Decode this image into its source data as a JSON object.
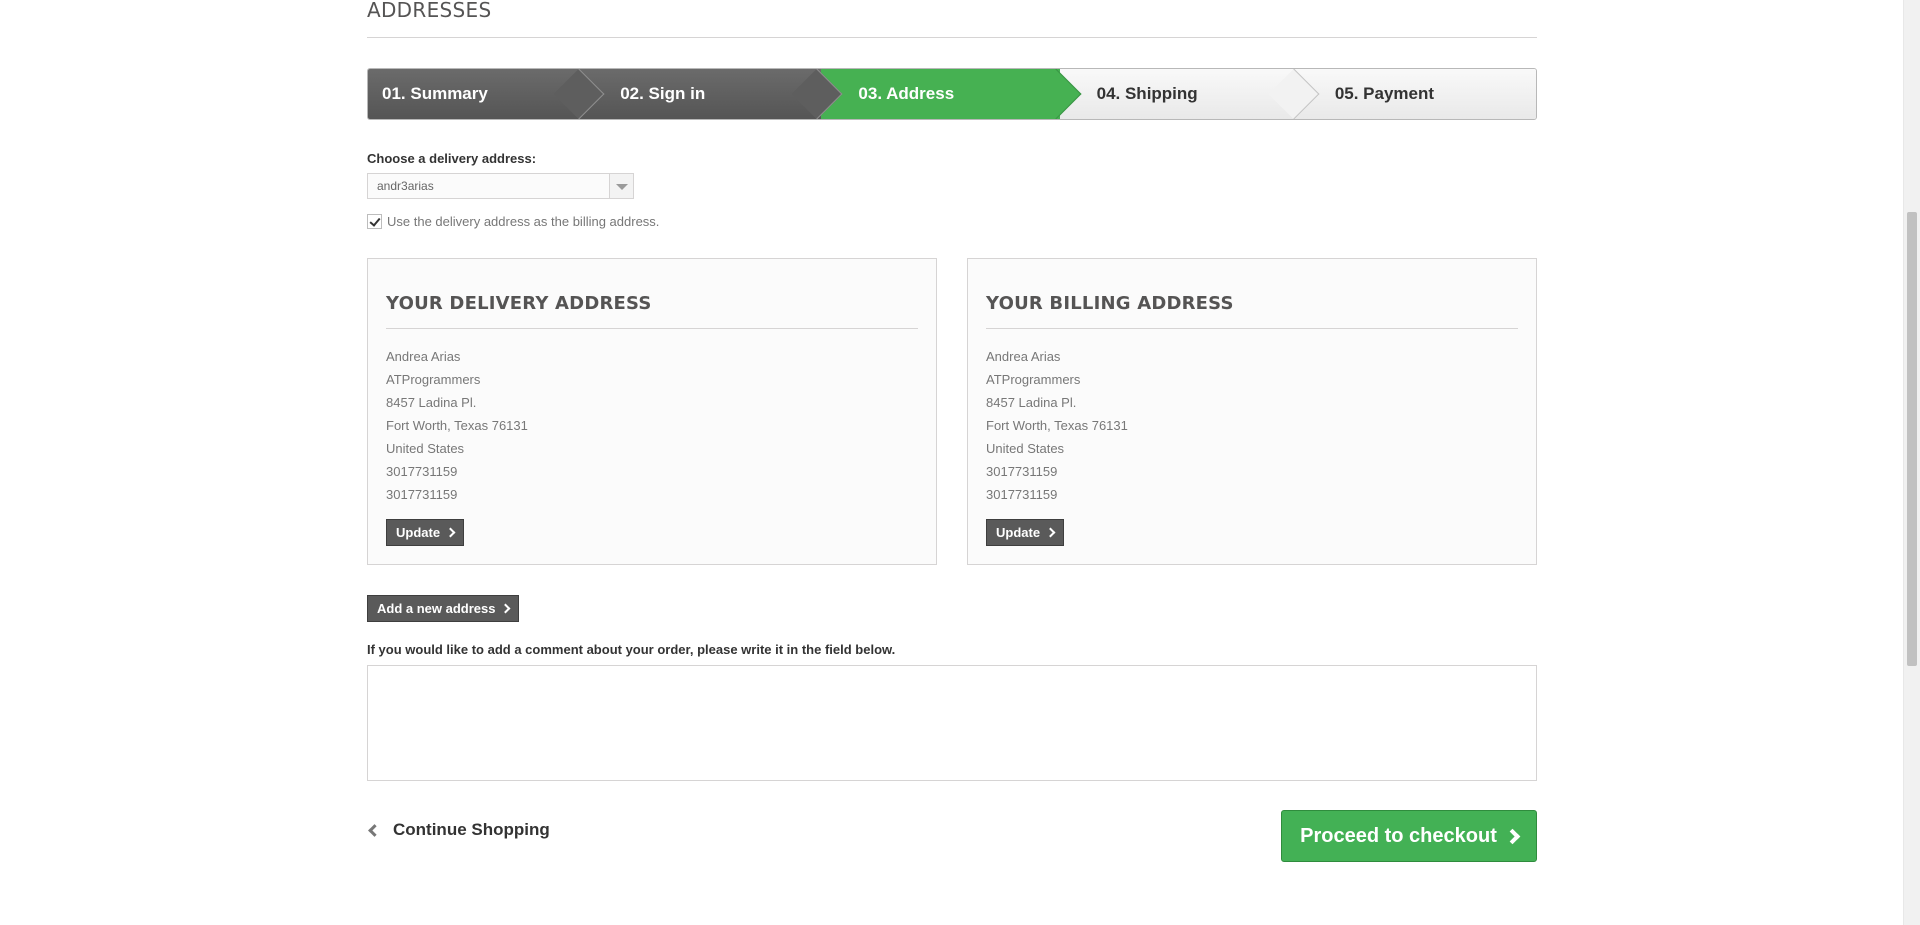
{
  "page": {
    "heading": "ADDRESSES"
  },
  "steps": [
    {
      "label": "01. Summary",
      "state": "done"
    },
    {
      "label": "02. Sign in",
      "state": "done"
    },
    {
      "label": "03. Address",
      "state": "current"
    },
    {
      "label": "04. Shipping",
      "state": "todo"
    },
    {
      "label": "05. Payment",
      "state": "todo"
    }
  ],
  "delivery_select": {
    "label": "Choose a delivery address:",
    "value": "andr3arias"
  },
  "billing_checkbox": {
    "label": "Use the delivery address as the billing address.",
    "checked": true
  },
  "delivery_address": {
    "title": "YOUR DELIVERY ADDRESS",
    "lines": [
      "Andrea Arias",
      "ATProgrammers",
      "8457 Ladina Pl.",
      "Fort Worth, Texas 76131",
      "United States",
      "3017731159",
      "3017731159"
    ],
    "update_label": "Update"
  },
  "billing_address": {
    "title": "YOUR BILLING ADDRESS",
    "lines": [
      "Andrea Arias",
      "ATProgrammers",
      "8457 Ladina Pl.",
      "Fort Worth, Texas 76131",
      "United States",
      "3017731159",
      "3017731159"
    ],
    "update_label": "Update"
  },
  "add_address_label": "Add a new address",
  "comment": {
    "label": "If you would like to add a comment about your order, please write it in the field below.",
    "value": ""
  },
  "continue_label": "Continue Shopping",
  "checkout_label": "Proceed to checkout",
  "colors": {
    "step_current": "#46b152",
    "step_done": "#5e5e5e",
    "checkout": "#43b155"
  }
}
